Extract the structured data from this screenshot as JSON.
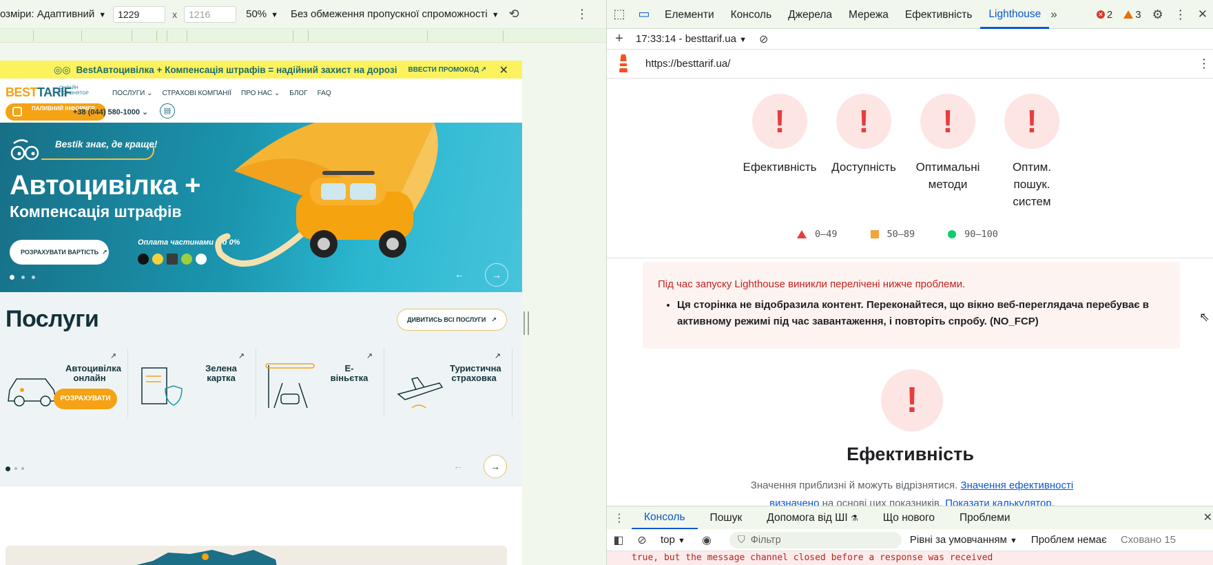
{
  "device_toolbar": {
    "dimensions_label": "озміри: Адаптивний",
    "width_value": "1229",
    "height_value": "1216",
    "times": "x",
    "zoom": "50%",
    "throttle": "Без обмеження пропускної спроможності"
  },
  "site": {
    "promo": {
      "text": "BestАвтоцивілка + Компенсація штрафів = надійний захист на дорозі",
      "code_link": "ВВЕСТИ ПРОМОКОД",
      "close": "✕"
    },
    "logo": {
      "best": "BEST",
      "tarif": "TARIF",
      "sub": "ОНЛАЙН ПОРІВНЯТОР"
    },
    "nav": [
      "ПОСЛУГИ",
      "СТРАХОВІ КОМПАНІЇ",
      "ПРО НАС",
      "БЛОГ",
      "FAQ"
    ],
    "fuel_button": "ПАЛИВНИЙ ІНФОРМЕР",
    "phone": "+38 (044) 580-1000",
    "hero": {
      "tagline": "Bestik знає, де краще!",
      "title": "Автоцивілка +",
      "subtitle": "Компенсація штрафів",
      "cta": "РОЗРАХУВАТИ ВАРТІСТЬ",
      "installments": "Оплата частинами під 0%"
    },
    "services": {
      "title": "Послуги",
      "all_link": "ДИВИТИСЬ ВСІ ПОСЛУГИ",
      "items": [
        {
          "label": "Автоцивілка онлайн",
          "button": "РОЗРАХУВАТИ"
        },
        {
          "label": "Зелена картка"
        },
        {
          "label": "Е-віньєтка"
        },
        {
          "label": "Туристична страховка"
        }
      ]
    }
  },
  "devtools": {
    "tabs": [
      "Елементи",
      "Консоль",
      "Джерела",
      "Мережа",
      "Ефективність",
      "Lighthouse"
    ],
    "active_tab": "Lighthouse",
    "errors": "2",
    "warnings": "3",
    "report_selector": "17:33:14 - besttarif.ua",
    "url": "https://besttarif.ua/",
    "gauges": [
      {
        "symbol": "!",
        "label": "Ефективність"
      },
      {
        "symbol": "!",
        "label": "Доступність"
      },
      {
        "symbol": "!",
        "label": "Оптимальні методи"
      },
      {
        "symbol": "!",
        "label": "Оптим. пошук. систем"
      }
    ],
    "legend": [
      "0–49",
      "50–89",
      "90–100"
    ],
    "warning_intro": "Під час запуску Lighthouse виникли перелічені нижче проблеми.",
    "warning_item": "Ця сторінка не відобразила контент. Переконайтеся, що вікно веб-переглядача перебуває в активному режимі під час завантаження, і повторіть спробу. (NO_FCP)",
    "performance": {
      "symbol": "!",
      "title": "Ефективність",
      "desc_text": "Значення приблизні й можуть відрізнятися.",
      "link1": "Значення ефективності визначено",
      "desc_mid": "на основі цих показників.",
      "link2": "Показати калькулятор."
    },
    "drawer": {
      "tabs": [
        "Консоль",
        "Пошук",
        "Допомога від ШІ",
        "Що нового",
        "Проблеми"
      ],
      "active": "Консоль",
      "context": "top",
      "filter_placeholder": "Фільтр",
      "levels": "Рівні за умовчанням",
      "no_issues": "Проблем немає",
      "hidden": "Сховано 15",
      "message": "true, but the message channel closed before a response was received"
    }
  }
}
